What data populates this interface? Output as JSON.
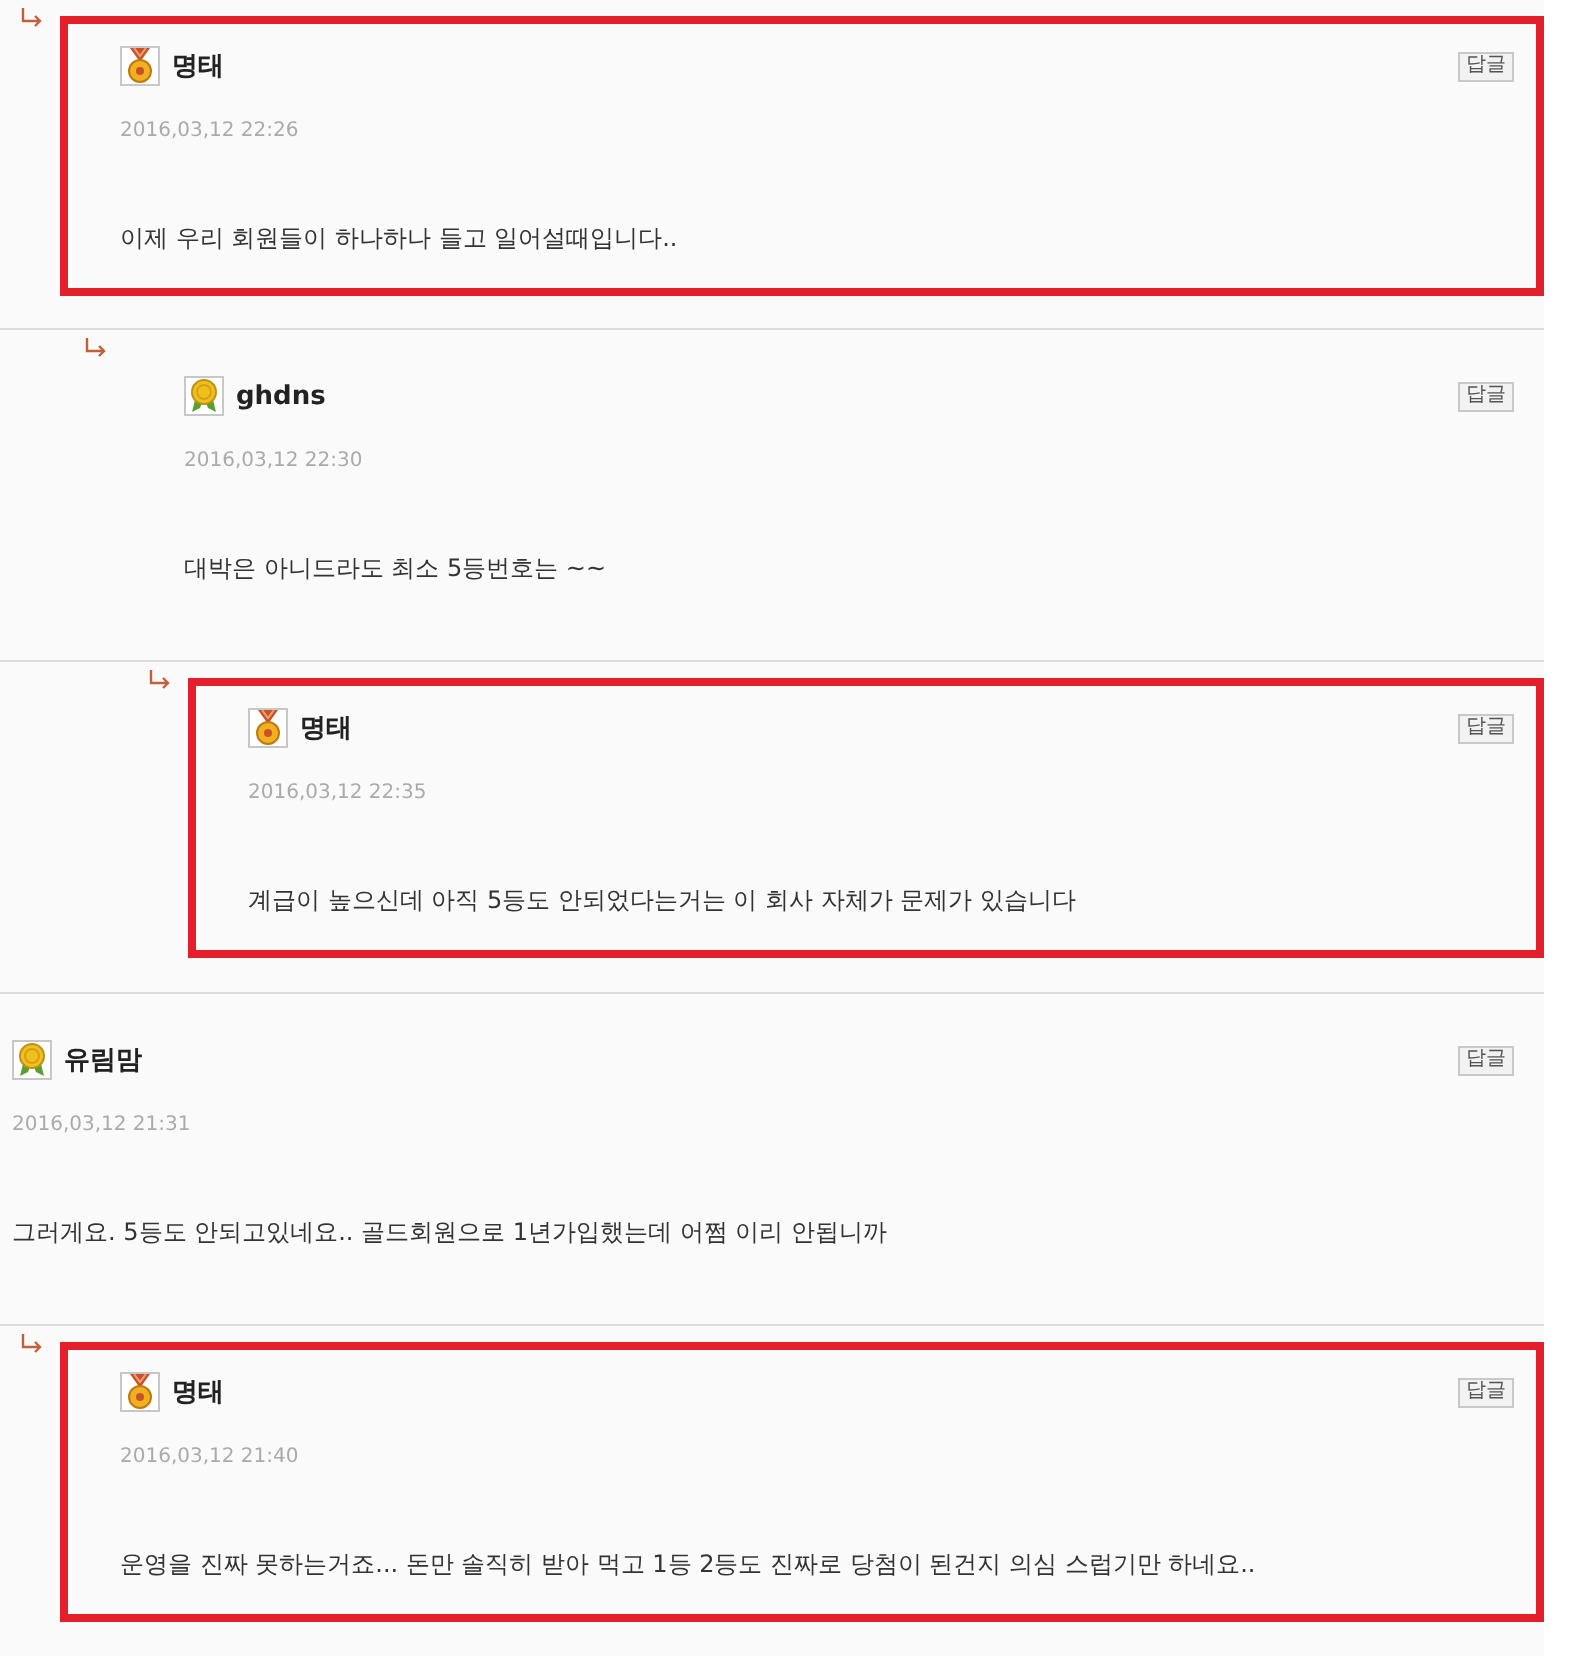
{
  "comments": [
    {
      "author": "명태",
      "kind": "medal",
      "date": "2016,03,12 22:26",
      "text": "이제 우리 회원들이 하나하나 들고 일어설때입니다..",
      "reply_label": "답글",
      "highlighted": true,
      "is_reply": true,
      "children": [
        {
          "author": "ghdns",
          "kind": "rosette",
          "date": "2016,03,12 22:30",
          "text": "대박은 아니드라도 최소 5등번호는 ~~",
          "reply_label": "답글",
          "highlighted": false,
          "is_reply": true,
          "children": [
            {
              "author": "명태",
              "kind": "medal",
              "date": "2016,03,12 22:35",
              "text": "계급이 높으신데 아직 5등도 안되었다는거는 이 회사 자체가 문제가 있습니다",
              "reply_label": "답글",
              "highlighted": true,
              "is_reply": true
            }
          ]
        }
      ]
    },
    {
      "author": "유림맘",
      "kind": "rosette",
      "date": "2016,03,12 21:31",
      "text": "그러게요. 5등도 안되고있네요.. 골드회원으로 1년가입했는데 어쩜 이리 안됩니까",
      "reply_label": "답글",
      "highlighted": false,
      "is_reply": false,
      "children": [
        {
          "author": "명태",
          "kind": "medal",
          "date": "2016,03,12 21:40",
          "text": "운영을 진짜 못하는거죠... 돈만 솔직히 받아 먹고 1등 2등도 진짜로 당첨이 된건지 의심 스럽기만 하네요..",
          "reply_label": "답글",
          "highlighted": true,
          "is_reply": true
        }
      ]
    }
  ]
}
